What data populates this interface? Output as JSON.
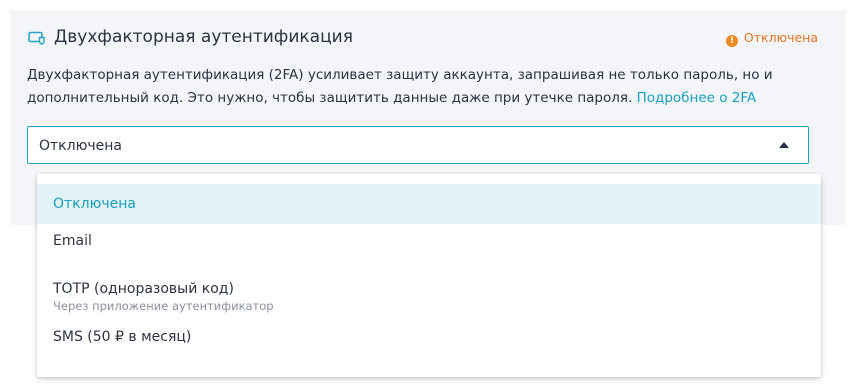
{
  "section": {
    "title": "Двухфакторная аутентификация",
    "icon": "device-shield-icon",
    "status": "Отключена",
    "status_color": "#e7741f",
    "description_text": "Двухфакторная аутентификация (2FA) усиливает защиту аккаунта, запрашивая не только пароль, но и дополнительный код. Это нужно, чтобы защитить данные даже при утечке пароля. ",
    "learn_more_link": "Подробнее о 2FA"
  },
  "select": {
    "value": "Отключена",
    "accent_color": "#23a3bf",
    "options": [
      {
        "label": "Отключена",
        "selected": true
      },
      {
        "label": "Email"
      },
      {
        "label": "TOTP (одноразовый код)",
        "sublabel": "Через приложение аутентификатор"
      },
      {
        "label": "SMS (50 ₽ в месяц)"
      }
    ]
  }
}
